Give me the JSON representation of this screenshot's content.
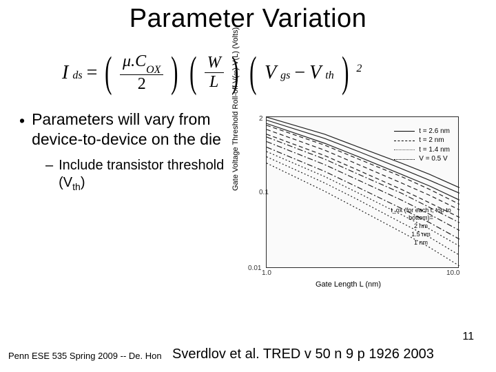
{
  "title": "Parameter Variation",
  "equation": {
    "lhs_var": "I",
    "lhs_sub": "ds",
    "eq": "=",
    "frac1_num_a": "μ.C",
    "frac1_num_sub": "OX",
    "frac1_den": "2",
    "frac2_num": "W",
    "frac2_den": "L",
    "term3_a": "V",
    "term3_a_sub": "gs",
    "term3_minus": "−",
    "term3_b": "V",
    "term3_b_sub": "th",
    "term3_exp": "2"
  },
  "bullets": {
    "b1": "Parameters will vary from device-to-device on the die",
    "b2_pre": "Include transistor threshold (V",
    "b2_sub": "th",
    "b2_post": ")"
  },
  "chart_data": {
    "type": "line",
    "title": "",
    "xlabel": "Gate Length L (nm)",
    "ylabel": "Gate Voltage Threshold Roll-off V(∞)-V(L) (Volts)",
    "xscale": "log",
    "yscale": "log",
    "xlim": [
      1.0,
      10.0
    ],
    "ylim": [
      0.01,
      2.0
    ],
    "x": [
      1.0,
      2.0,
      3.0,
      5.0,
      7.0,
      10.0
    ],
    "legend_outer": [
      {
        "name": "t = 2.6 nm",
        "style": "solid"
      },
      {
        "name": "t = 2 nm",
        "style": "dash"
      },
      {
        "name": "t = 1.4 nm",
        "style": "dashdot"
      },
      {
        "name": "V = 0.5 V",
        "style": "dotted"
      }
    ],
    "inset_label": "t_ox (for each t, top to bottom)=",
    "inset_values": [
      "2 nm",
      "1.5 nm",
      "1 nm"
    ],
    "series": [
      {
        "name": "t=2.6 tox=2",
        "values": [
          2.0,
          1.1,
          0.7,
          0.4,
          0.27,
          0.17
        ]
      },
      {
        "name": "t=2.6 tox=1.5",
        "values": [
          1.8,
          0.95,
          0.6,
          0.33,
          0.22,
          0.14
        ]
      },
      {
        "name": "t=2.6 tox=1",
        "values": [
          1.6,
          0.8,
          0.5,
          0.27,
          0.18,
          0.11
        ]
      },
      {
        "name": "t=2 tox=2",
        "values": [
          1.5,
          0.75,
          0.46,
          0.25,
          0.16,
          0.095
        ]
      },
      {
        "name": "t=2 tox=1.5",
        "values": [
          1.3,
          0.63,
          0.38,
          0.2,
          0.13,
          0.078
        ]
      },
      {
        "name": "t=2 tox=1",
        "values": [
          1.1,
          0.52,
          0.31,
          0.16,
          0.1,
          0.06
        ]
      },
      {
        "name": "t=1.4 tox=2",
        "values": [
          1.0,
          0.46,
          0.27,
          0.14,
          0.085,
          0.05
        ]
      },
      {
        "name": "t=1.4 tox=1.5",
        "values": [
          0.85,
          0.38,
          0.22,
          0.11,
          0.067,
          0.038
        ]
      },
      {
        "name": "t=1.4 tox=1",
        "values": [
          0.7,
          0.3,
          0.17,
          0.082,
          0.05,
          0.028
        ]
      },
      {
        "name": "V=0.5 tox=2",
        "values": [
          0.6,
          0.25,
          0.14,
          0.066,
          0.04,
          0.022
        ]
      },
      {
        "name": "V=0.5 tox=1.5",
        "values": [
          0.5,
          0.2,
          0.11,
          0.05,
          0.03,
          0.016
        ]
      },
      {
        "name": "V=0.5 tox=1",
        "values": [
          0.4,
          0.15,
          0.08,
          0.036,
          0.021,
          0.011
        ]
      }
    ]
  },
  "footer_left": "Penn ESE 535 Spring 2009 -- De. Hon",
  "citation": "Sverdlov et al. TRED v 50 n 9 p 1926 2003",
  "page_number": "11"
}
